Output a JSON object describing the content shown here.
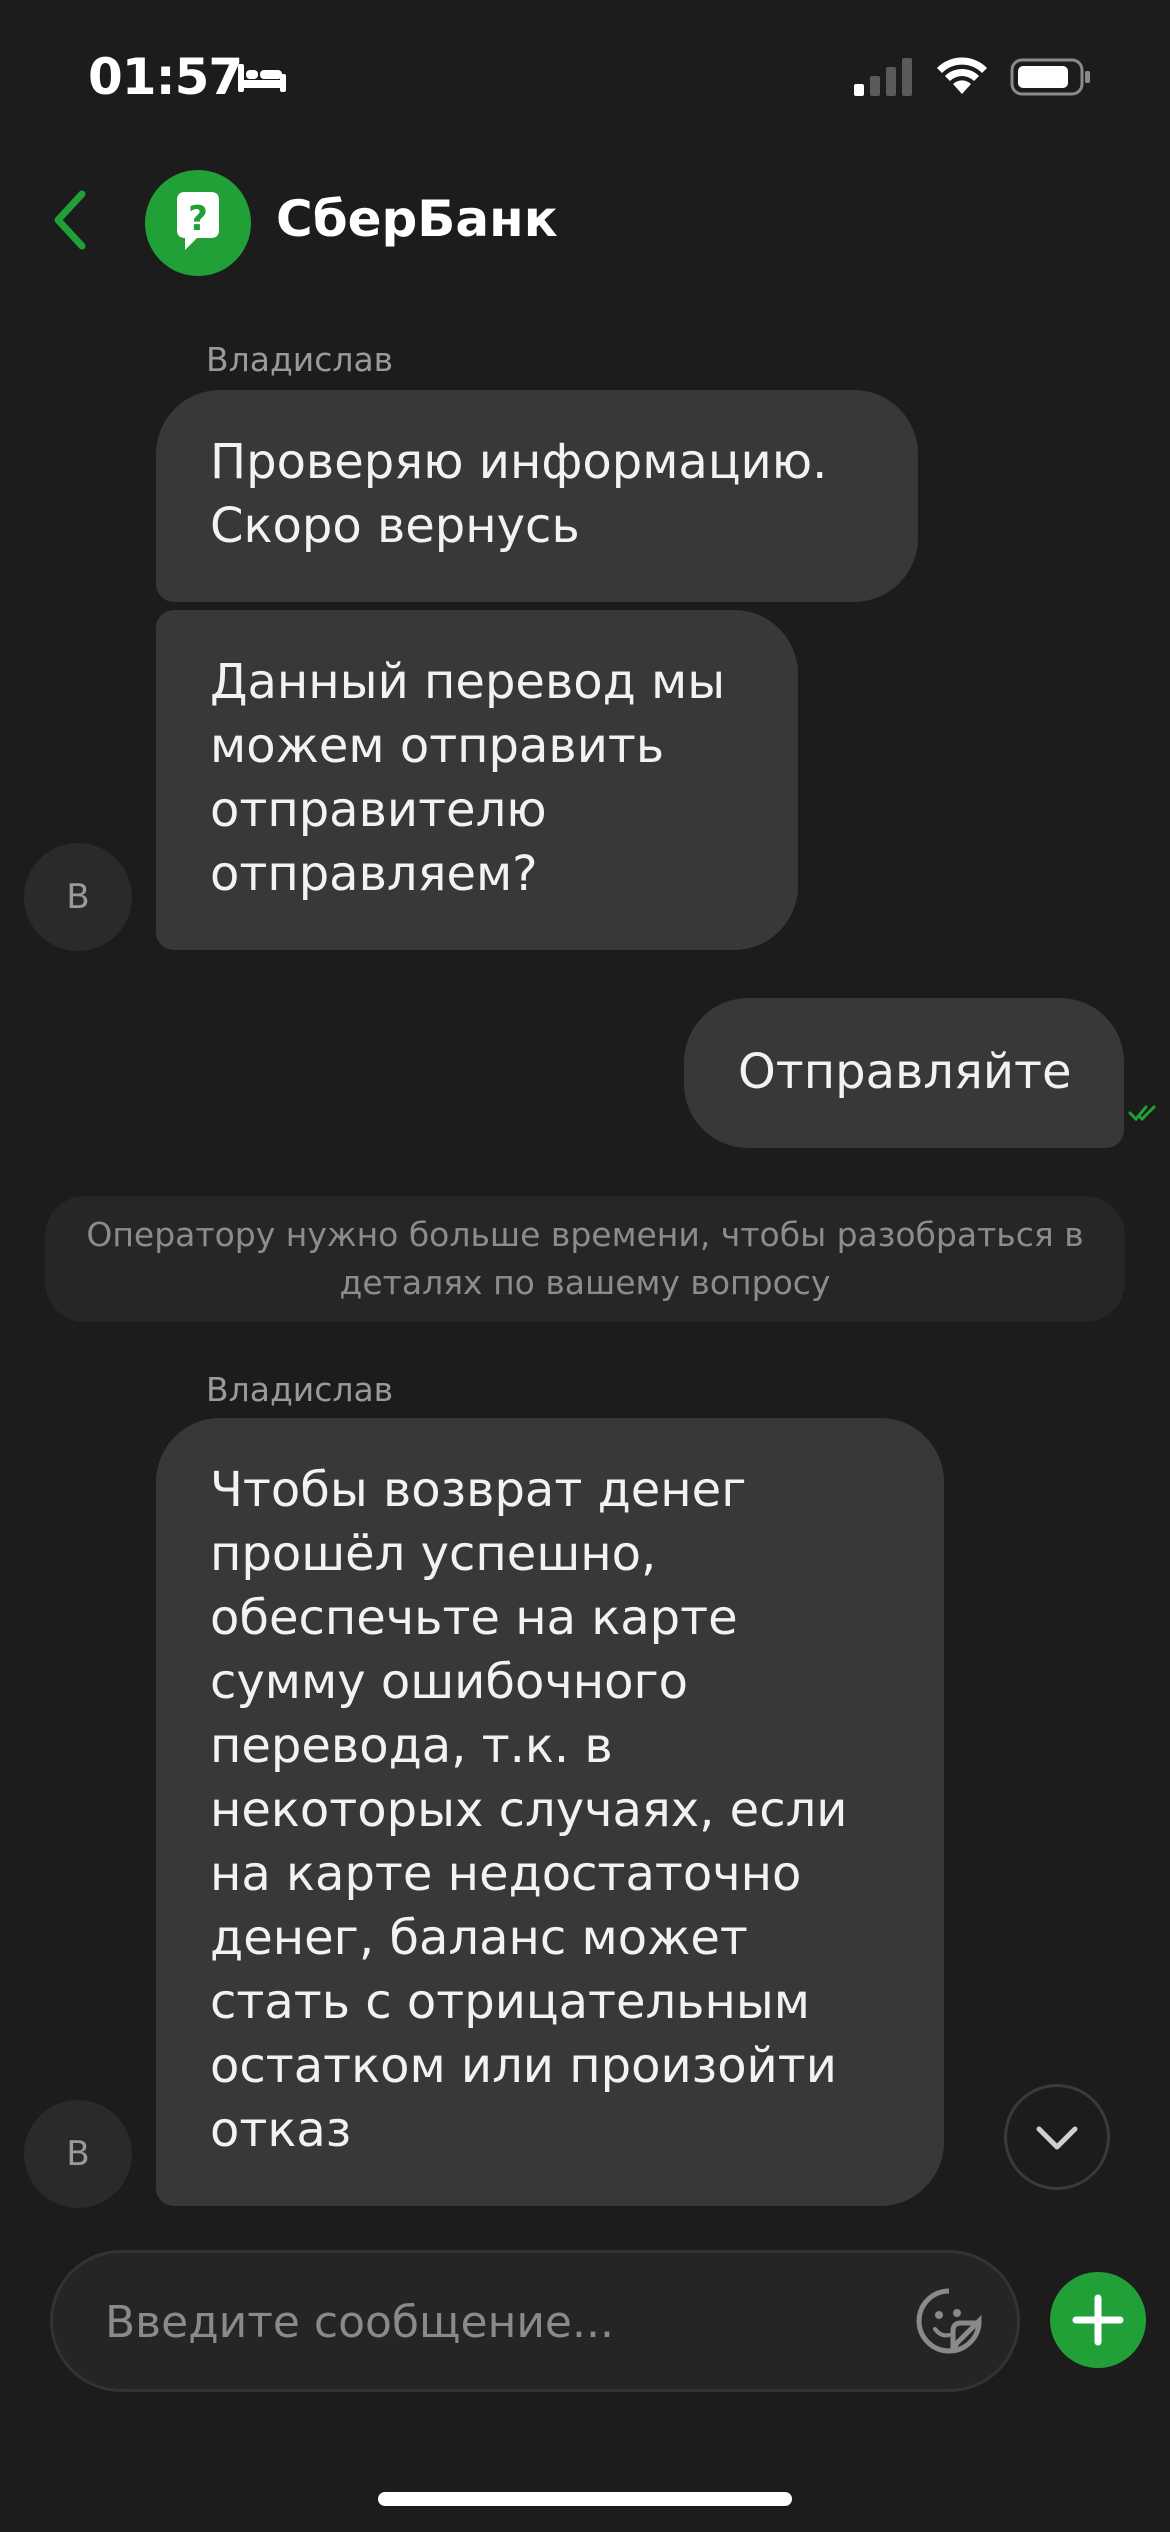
{
  "status_bar": {
    "time": "01:57"
  },
  "header": {
    "title": "СберБанк",
    "avatar_icon": "question-mark-icon",
    "back_icon": "chevron-left-icon",
    "accent": "#21a038"
  },
  "chat": {
    "sender_1": "Владислав",
    "msg_1": "Проверяю информацию. Скоро вернусь",
    "msg_2": "Данный перевод мы можем отправить отправителю отправляем?",
    "avatar_1": "В",
    "user_msg": "Отправляйте",
    "system_note": "Оператору нужно больше времени, чтобы разобраться в деталях по вашему вопросу",
    "sender_2": "Владислав",
    "msg_3": "Чтобы возврат  денег прошёл успешно, обеспечьте на карте сумму ошибочного перевода, т.к. в некоторых случаях, если на карте недостаточно денег, баланс может стать с отрицательным остатком или произойти отказ",
    "avatar_2": "В"
  },
  "input": {
    "placeholder": "Введите сообщение..."
  }
}
